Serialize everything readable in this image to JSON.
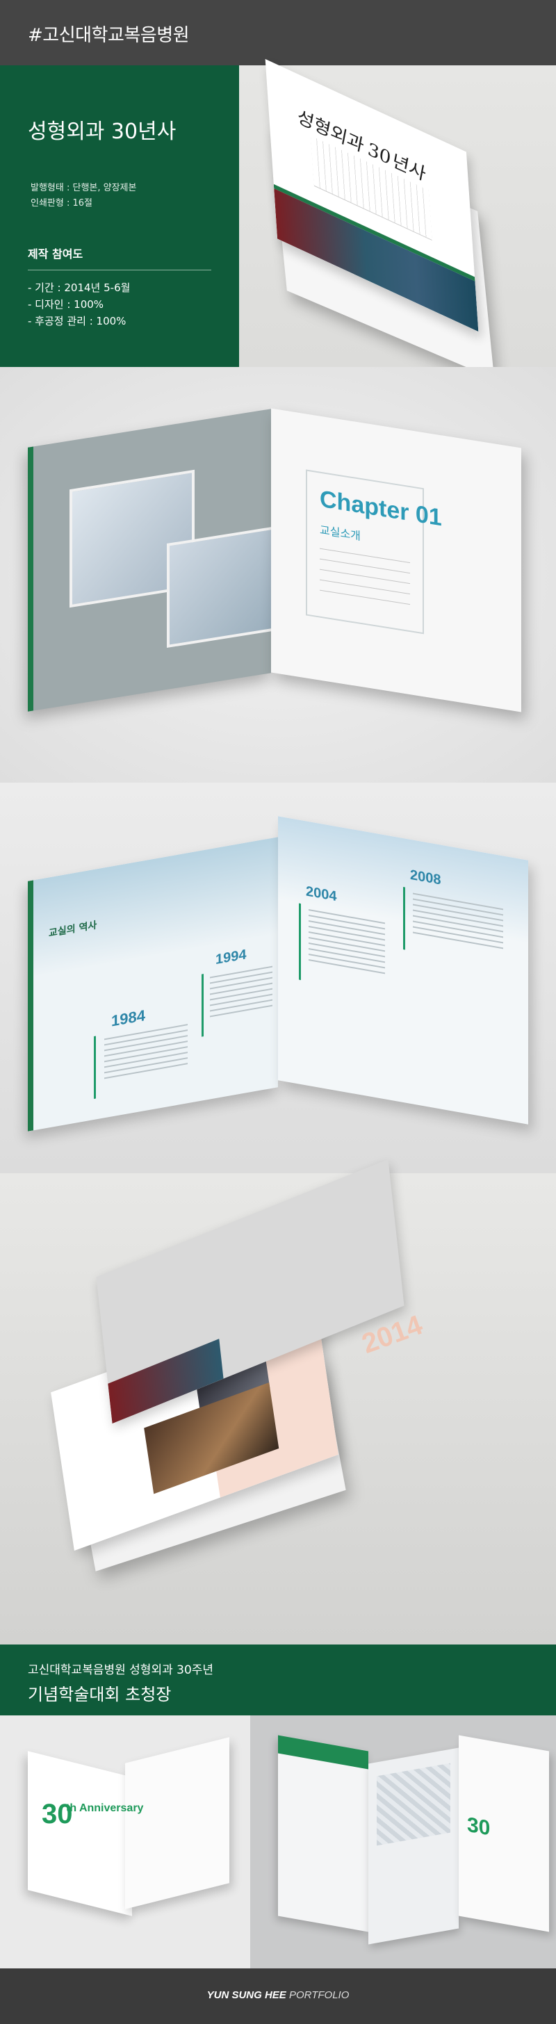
{
  "header": {
    "title": "#고신대학교복음병원"
  },
  "project": {
    "title": "성형외과 30년사",
    "info": [
      "발행형태 : 단행본, 양장제본",
      "인쇄판형 : 16절"
    ],
    "participation_title": "제작 참여도",
    "participation": [
      "- 기간 : 2014년 5-6월",
      "- 디자인 : 100%",
      "- 후공정 관리 : 100%"
    ]
  },
  "book_cover": {
    "calligraphy": "성형외과 30년사"
  },
  "spread_chapter": {
    "chapter": "Chapter 01",
    "subtitle": "교실소개"
  },
  "timeline": {
    "title": "교실의 역사",
    "years": [
      "1984",
      "1994",
      "2004",
      "2008"
    ]
  },
  "open_book": {
    "year": "2014"
  },
  "invitation": {
    "line1": "고신대학교복음병원 성형외과 30주년",
    "line2": "기념학술대회 초청장",
    "badge_number": "30",
    "badge_text": "th Anniversary"
  },
  "footer": {
    "name": "YUN SUNG HEE",
    "suffix": "PORTFOLIO"
  }
}
